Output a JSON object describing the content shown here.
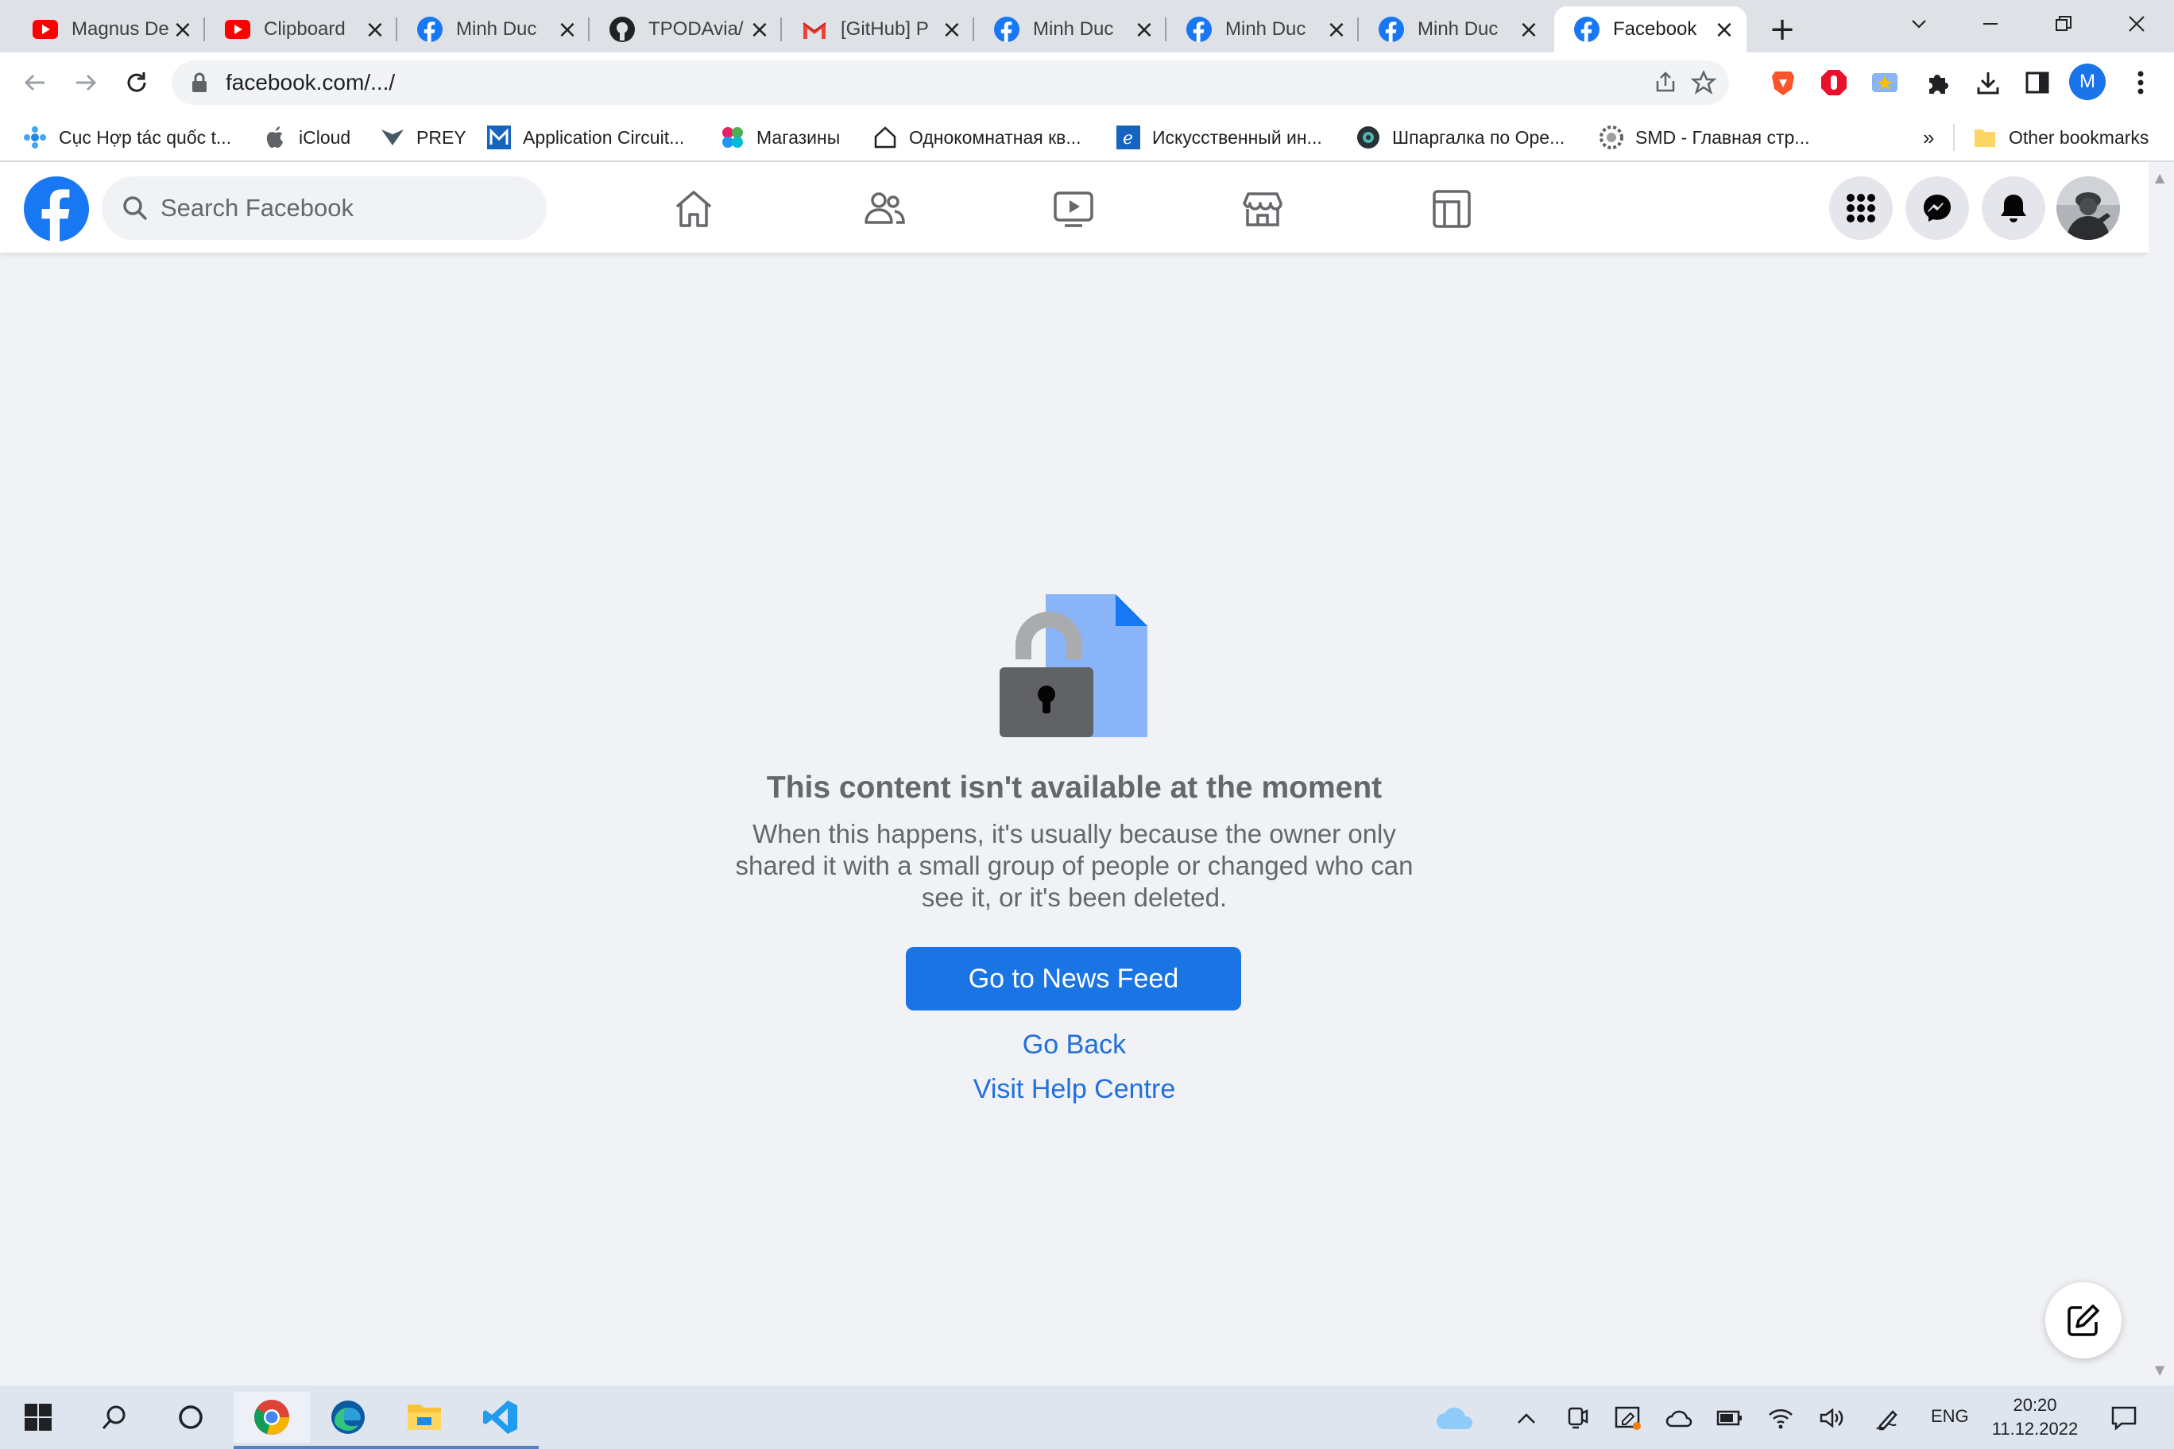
{
  "browser": {
    "tabs": [
      {
        "title": "Magnus De",
        "favicon": "youtube-icon"
      },
      {
        "title": "Clipboard",
        "favicon": "youtube-icon"
      },
      {
        "title": "Minh Duc",
        "favicon": "facebook-icon"
      },
      {
        "title": "TPODAvia/",
        "favicon": "github-icon"
      },
      {
        "title": "[GitHub] P",
        "favicon": "gmail-icon"
      },
      {
        "title": "Minh Duc",
        "favicon": "facebook-icon"
      },
      {
        "title": "Minh Duc",
        "favicon": "facebook-icon"
      },
      {
        "title": "Minh Duc",
        "favicon": "facebook-icon"
      },
      {
        "title": "Facebook",
        "favicon": "facebook-icon",
        "active": true
      }
    ],
    "address": "facebook.com/.../",
    "profile_initial": "M",
    "bookmarks": [
      "Cục Hợp tác quốc t...",
      "iCloud",
      "PREY",
      "Application Circuit...",
      "Магазины",
      "Однокомнатная кв...",
      "Искусственный ин...",
      "Шпаргалка по Ope...",
      "SMD - Главная стр..."
    ],
    "bookmarks_overflow": "»",
    "other_bookmarks": "Other bookmarks"
  },
  "facebook": {
    "search_placeholder": "Search Facebook",
    "nav": [
      "home-icon",
      "friends-icon",
      "watch-icon",
      "marketplace-icon",
      "gaming-icon"
    ],
    "brand_color": "#1877f2"
  },
  "message": {
    "title": "This content isn't available at the moment",
    "description_lines": [
      "When this happens, it's usually because the owner only",
      "shared it with a small group of people or changed who can",
      "see it, or it's been deleted."
    ],
    "primary_action": "Go to News Feed",
    "secondary_action": "Go Back",
    "help_action": "Visit Help Centre"
  },
  "taskbar": {
    "language": "ENG",
    "time": "20:20",
    "date": "11.12.2022"
  }
}
